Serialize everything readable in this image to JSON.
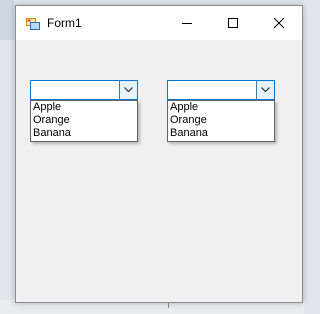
{
  "window": {
    "title": "Form1",
    "minimize_icon": "minimize-icon",
    "maximize_icon": "maximize-icon",
    "close_icon": "close-icon"
  },
  "combo_left": {
    "value": "",
    "dropdown_icon": "chevron-down-icon",
    "items": [
      "Apple",
      "Orange",
      "Banana"
    ]
  },
  "combo_right": {
    "value": "",
    "dropdown_icon": "chevron-down-icon",
    "items": [
      "Apple",
      "Orange",
      "Banana"
    ]
  },
  "colors": {
    "focus_border": "#0078d7",
    "form_bg": "#f0f0f0",
    "titlebar_bg": "#ffffff"
  }
}
